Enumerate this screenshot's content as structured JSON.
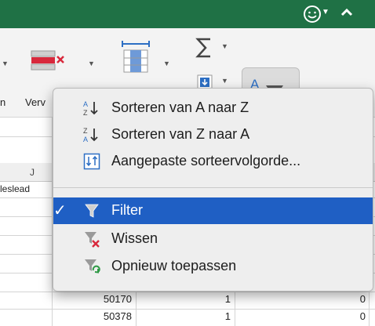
{
  "ribbon": {
    "partial_labels": [
      "n",
      "Verv"
    ]
  },
  "sheet": {
    "column_letter": "J",
    "cell_partial_text": "leslead",
    "rows": [
      {
        "a": "50170",
        "b": "1",
        "c": "0"
      },
      {
        "a": "50378",
        "b": "1",
        "c": "0"
      }
    ]
  },
  "menu": {
    "items": [
      {
        "label": "Sorteren van A naar Z",
        "icon": "sort-a-to-z-icon"
      },
      {
        "label": "Sorteren van Z naar A",
        "icon": "sort-z-to-a-icon"
      },
      {
        "label": "Aangepaste sorteervolgorde...",
        "icon": "custom-sort-icon"
      },
      {
        "label": "Filter",
        "icon": "filter-icon",
        "checked": true
      },
      {
        "label": "Wissen",
        "icon": "clear-filter-icon"
      },
      {
        "label": "Opnieuw toepassen",
        "icon": "reapply-filter-icon"
      }
    ]
  },
  "colors": {
    "titlebar": "#1f7145",
    "selection": "#1f5fc4"
  }
}
